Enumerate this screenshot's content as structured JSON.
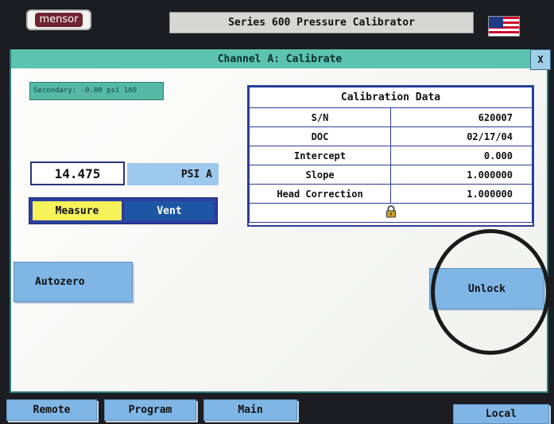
{
  "brand": {
    "logo_text": "mensor"
  },
  "header": {
    "title": "Series 600 Pressure Calibrator",
    "flag_icon": "us-flag-icon"
  },
  "panel": {
    "channel_title": "Channel A: Calibrate",
    "close_label": "X",
    "secondary": "Secondary: -0.00 psi 160"
  },
  "reading": {
    "value": "14.475",
    "unit": "PSI A"
  },
  "mode": {
    "measure_label": "Measure",
    "vent_label": "Vent"
  },
  "calibration": {
    "title": "Calibration Data",
    "rows": [
      {
        "label": "S/N",
        "value": "620007"
      },
      {
        "label": "DOC",
        "value": "02/17/04"
      },
      {
        "label": "Intercept",
        "value": "0.000"
      },
      {
        "label": "Slope",
        "value": "1.000000"
      },
      {
        "label": "Head Correction",
        "value": "1.000000"
      }
    ],
    "lock_icon": "padlock-icon"
  },
  "buttons": {
    "autozero_label": "Autozero",
    "unlock_label": "Unlock"
  },
  "nav": {
    "remote_label": "Remote",
    "program_label": "Program",
    "main_label": "Main",
    "local_label": "Local"
  },
  "colors": {
    "channel_bar": "#5cc3b1",
    "button_blue": "#7fb6e6",
    "measure_yellow": "#f6f25a",
    "vent_blue": "#1e56a6",
    "table_border": "#2b3e9a"
  }
}
